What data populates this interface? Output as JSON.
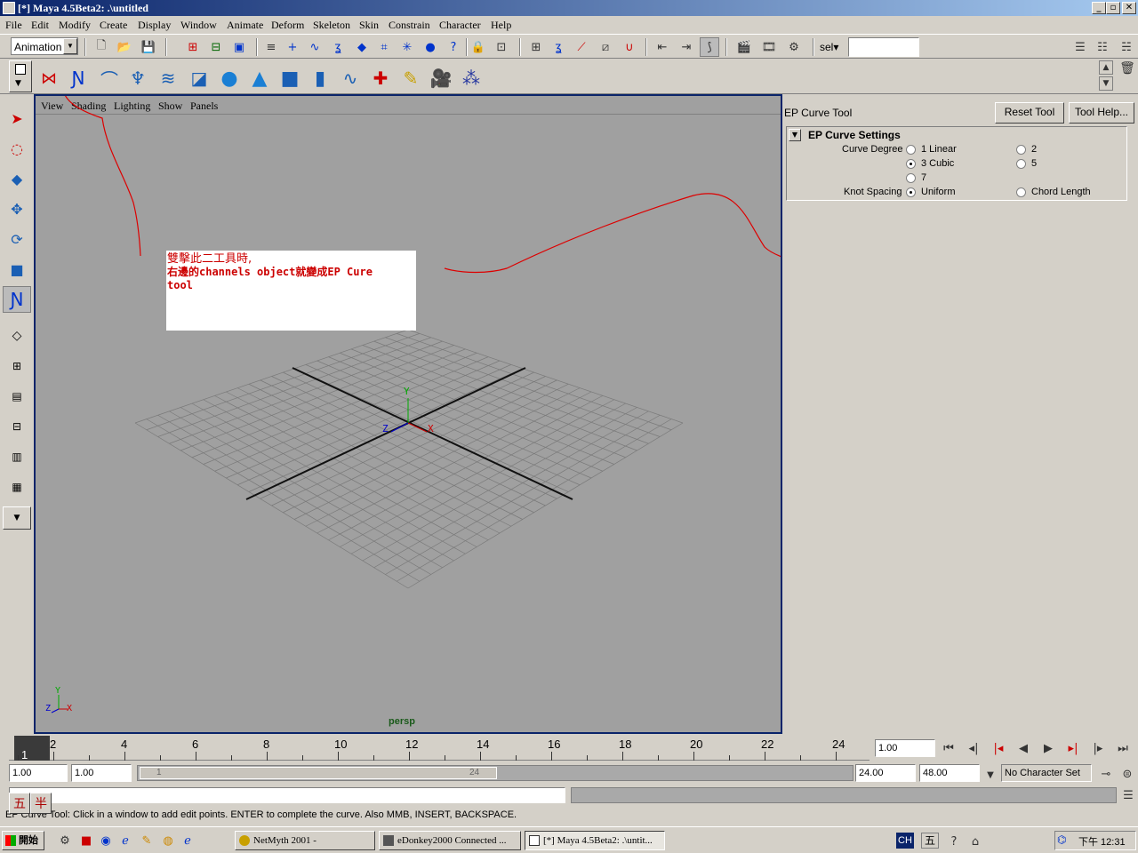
{
  "window": {
    "title": "[*] Maya 4.5Beta2: .\\untitled",
    "min": "_",
    "max": "▫",
    "close": "✕"
  },
  "menu": [
    "File",
    "Edit",
    "Modify",
    "Create",
    "Display",
    "Window",
    "Animate",
    "Deform",
    "Skeleton",
    "Skin",
    "Constrain",
    "Character",
    "Help"
  ],
  "status_line": {
    "menu_set": "Animation",
    "sel_label": "sel▾",
    "sel_value": ""
  },
  "viewport": {
    "menu": [
      "View",
      "Shading",
      "Lighting",
      "Show",
      "Panels"
    ],
    "camera_label": "persp",
    "axis_y": "Y",
    "axis_x": "X",
    "axis_z": "Z",
    "annotation_line1": "雙擊此二工具時,",
    "annotation_line2": "右邊的channels object就變成EP Cure",
    "annotation_line3": "tool",
    "colors": {
      "annotation_text": "#cc0000",
      "grid": "#7a7a7a",
      "background": "#a0a0a0"
    }
  },
  "tool_panel": {
    "title": "EP Curve Tool",
    "reset_button": "Reset Tool",
    "help_button": "Tool Help...",
    "section_title": "EP Curve Settings",
    "curve_degree_label": "Curve Degree",
    "degree_options": [
      "1 Linear",
      "2",
      "3 Cubic",
      "5",
      "7"
    ],
    "degree_selected": "3 Cubic",
    "knot_spacing_label": "Knot Spacing",
    "knot_options": [
      "Uniform",
      "Chord Length"
    ],
    "knot_selected": "Uniform"
  },
  "timeline": {
    "ticks": [
      "1",
      "2",
      "4",
      "6",
      "8",
      "10",
      "12",
      "14",
      "16",
      "18",
      "20",
      "22",
      "24"
    ],
    "current_time": "1.00"
  },
  "range_slider": {
    "start": "1.00",
    "playback_start": "1.00",
    "slider_start": "1",
    "slider_end": "24",
    "playback_end": "24.00",
    "end": "48.00",
    "character_set": "No Character Set"
  },
  "help_line": {
    "ime1": "五",
    "ime2": "半",
    "text": "EP Curve Tool: Click in a window to add edit points. ENTER to complete the curve. Also MMB, INSERT, BACKSPACE."
  },
  "taskbar": {
    "start": "開始",
    "tasks": [
      "NetMyth 2001 -",
      "eDonkey2000 Connected ...",
      "[*] Maya 4.5Beta2: .\\untit..."
    ],
    "lang": "CH",
    "ime": "五",
    "clock": "下午 12:31"
  }
}
